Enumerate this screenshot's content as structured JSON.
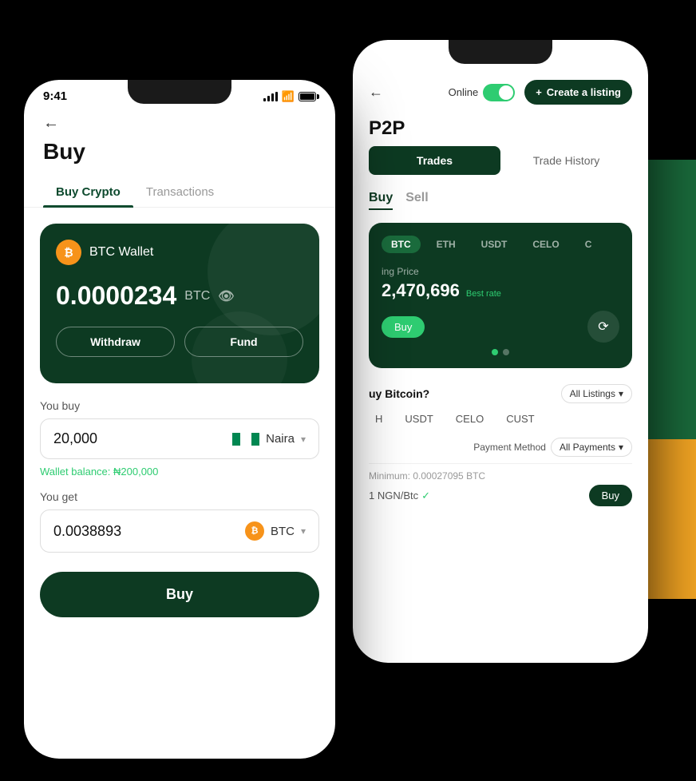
{
  "scene": {
    "background": "#000"
  },
  "phone_back": {
    "screen": "P2P",
    "status": {
      "time": "",
      "online_label": "Online",
      "online_active": true
    },
    "header": {
      "title": "P2P",
      "back_arrow": "←",
      "create_listing_label": "Create a listing",
      "create_listing_icon": "+"
    },
    "tabs": {
      "trades_label": "Trades",
      "history_label": "Trade History"
    },
    "buy_sell": {
      "buy_label": "Buy",
      "sell_label": "Sell"
    },
    "crypto_chips": [
      "BTC",
      "ETH",
      "USDT",
      "CELO",
      "C"
    ],
    "carousel": {
      "price_label": "ing Price",
      "price_value": "2,470,696",
      "best_rate_label": "Best rate",
      "dots": [
        true,
        false
      ]
    },
    "listings_section": {
      "title": "uy Bitcoin?",
      "all_listings_label": "All Listings",
      "crypto_filters": [
        "H",
        "USDT",
        "CELO",
        "CUST"
      ],
      "payment_method_label": "Payment Method",
      "payment_btn_label": "All Payments"
    },
    "listing_footer": {
      "minimum": "Minimum: 0.00027095 BTC",
      "price": "1 NGN/Btc",
      "buy_btn_label": "Buy"
    }
  },
  "phone_front": {
    "screen": "Buy",
    "status": {
      "time": "9:41"
    },
    "header": {
      "back_arrow": "←",
      "title": "Buy"
    },
    "tabs": {
      "buy_crypto_label": "Buy Crypto",
      "transactions_label": "Transactions"
    },
    "wallet_card": {
      "icon_label": "₿",
      "wallet_name": "BTC Wallet",
      "balance": "0.0000234",
      "balance_unit": "BTC",
      "withdraw_label": "Withdraw",
      "fund_label": "Fund"
    },
    "buy_form": {
      "you_buy_label": "You buy",
      "amount": "20,000",
      "currency_flag": "NG",
      "currency_name": "Naira",
      "wallet_balance": "Wallet balance: ₦200,000",
      "you_get_label": "You get",
      "get_amount": "0.0038893",
      "get_currency": "BTC"
    },
    "buy_button_label": "Buy"
  }
}
